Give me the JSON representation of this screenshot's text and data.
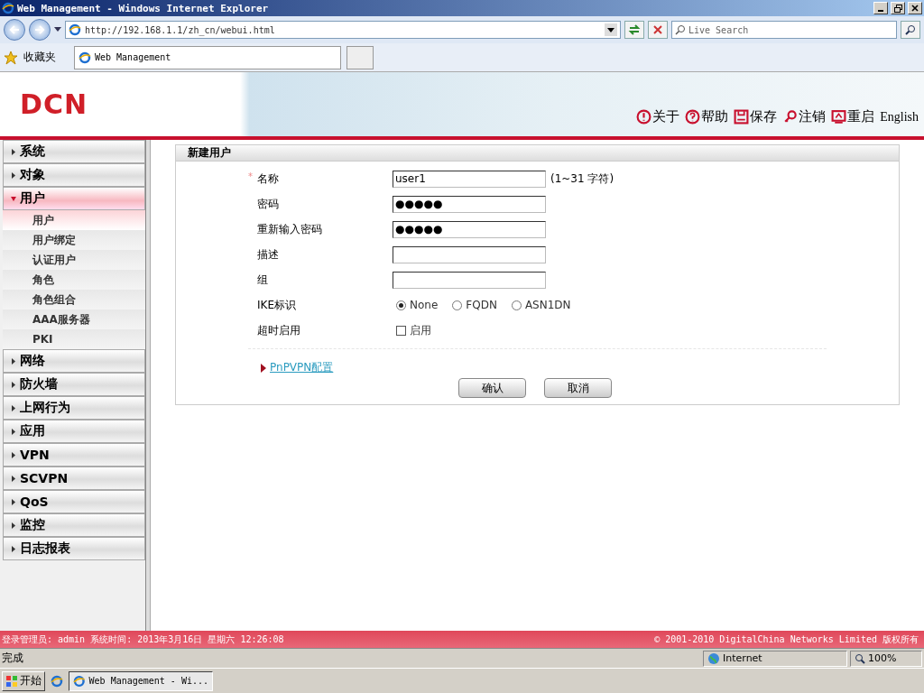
{
  "window": {
    "title": "Web Management - Windows Internet Explorer"
  },
  "address_bar": {
    "url": "http://192.168.1.1/zh_cn/webui.html",
    "search_placeholder": "Live Search"
  },
  "favorites_bar": {
    "label": "收藏夹",
    "tabs": [
      {
        "label": "Web Management",
        "selected": true
      }
    ]
  },
  "header": {
    "logo": "DCN",
    "actions": [
      {
        "kind": "about",
        "label": "关于"
      },
      {
        "kind": "help",
        "label": "帮助"
      },
      {
        "kind": "save",
        "label": "保存"
      },
      {
        "kind": "logout",
        "label": "注销"
      },
      {
        "kind": "restart",
        "label": "重启"
      }
    ],
    "language": "English"
  },
  "sidebar": {
    "items": [
      {
        "label": "系统",
        "expanded": false
      },
      {
        "label": "对象",
        "expanded": false
      },
      {
        "label": "用户",
        "expanded": true,
        "children": [
          {
            "label": "用户",
            "selected": true
          },
          {
            "label": "用户绑定",
            "selected": false
          },
          {
            "label": "认证用户",
            "selected": false
          },
          {
            "label": "角色",
            "selected": false
          },
          {
            "label": "角色组合",
            "selected": false
          },
          {
            "label": "AAA服务器",
            "selected": false
          },
          {
            "label": "PKI",
            "selected": false
          }
        ]
      },
      {
        "label": "网络",
        "expanded": false
      },
      {
        "label": "防火墙",
        "expanded": false
      },
      {
        "label": "上网行为",
        "expanded": false
      },
      {
        "label": "应用",
        "expanded": false
      },
      {
        "label": "VPN",
        "expanded": false
      },
      {
        "label": "SCVPN",
        "expanded": false
      },
      {
        "label": "QoS",
        "expanded": false
      },
      {
        "label": "监控",
        "expanded": false
      },
      {
        "label": "日志报表",
        "expanded": false
      }
    ]
  },
  "form": {
    "title": "新建用户",
    "fields": [
      {
        "kind": "text",
        "required_mark": "*",
        "label": "名称",
        "value": "user1",
        "hint": "(1~31 字符)"
      },
      {
        "kind": "text",
        "label": "密码",
        "value": "●●●●●"
      },
      {
        "kind": "text",
        "label": "重新输入密码",
        "value": "●●●●●"
      },
      {
        "kind": "text",
        "label": "描述"
      },
      {
        "kind": "text",
        "label": "组"
      },
      {
        "kind": "radio",
        "label": "IKE标识",
        "options": [
          {
            "label": "None",
            "selected": true
          },
          {
            "label": "FQDN",
            "selected": false
          },
          {
            "label": "ASN1DN",
            "selected": false
          }
        ]
      },
      {
        "kind": "checkbox",
        "label": "超时启用",
        "option": "启用",
        "checked": false
      }
    ],
    "link": "PnPVPN配置",
    "buttons": [
      "确认",
      "取消"
    ]
  },
  "footer": {
    "left": "登录管理员: admin 系统时间: 2013年3月16日 星期六 12:26:08",
    "right": "© 2001-2010 DigitalChina Networks Limited 版权所有"
  },
  "status_bar": {
    "status": "完成",
    "zone": "Internet",
    "zoom": "100%"
  },
  "taskbar": {
    "start": "开始",
    "tasks": [
      {
        "label": "Web Management - Wi...",
        "selected": true
      }
    ]
  }
}
